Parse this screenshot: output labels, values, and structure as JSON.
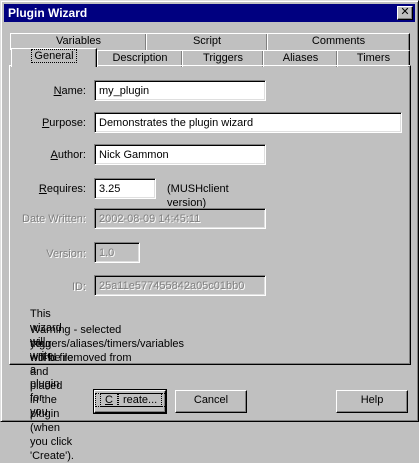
{
  "window": {
    "title": "Plugin Wizard",
    "close_glyph": "✕"
  },
  "tabs_back": [
    "Variables",
    "Script",
    "Comments"
  ],
  "tabs_front": [
    "General",
    "Description",
    "Triggers",
    "Aliases",
    "Timers"
  ],
  "fields": {
    "name": {
      "label_u": "N",
      "label_rest": "ame:",
      "value": "my_plugin"
    },
    "purpose": {
      "label_u": "P",
      "label_rest": "urpose:",
      "value": "Demonstrates the plugin wizard"
    },
    "author": {
      "label_u": "A",
      "label_rest": "uthor:",
      "value": "Nick Gammon"
    },
    "requires": {
      "label_u": "R",
      "label_rest": "equires:",
      "value": "3.25",
      "note": "(MUSHclient version)"
    },
    "date_written": {
      "label": "Date Written:",
      "value": "2002-08-09 14:45:11"
    },
    "version": {
      "label": "Version:",
      "value": "1.0"
    },
    "id": {
      "label": "ID:",
      "value": "25a11e577455842a05c01bb0"
    }
  },
  "info": {
    "line1": "This wizard will write a plugin for you.",
    "line2": "Warning - selected triggers/aliases/timers/variables will be removed from",
    "line3": "your world file and placed in the plugin (when you click 'Create')."
  },
  "buttons": {
    "create_u": "C",
    "create_rest": "reate...",
    "cancel": "Cancel",
    "help": "Help"
  }
}
